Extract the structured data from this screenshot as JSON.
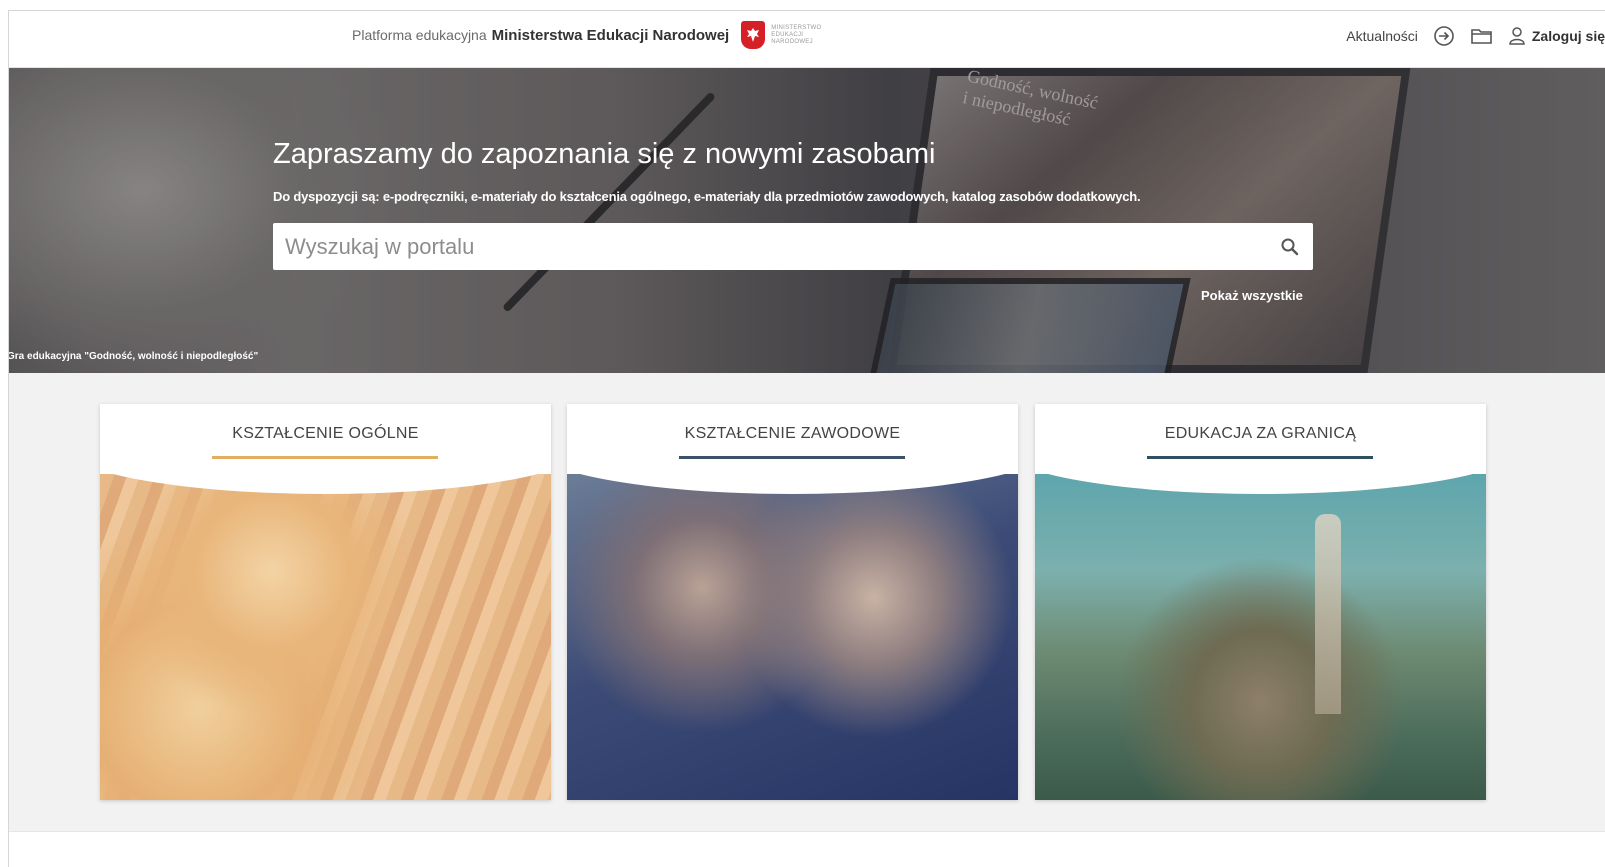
{
  "header": {
    "platform_prefix": "Platforma edukacyjna",
    "platform_name": "Ministerstwa Edukacji Narodowej",
    "logo_text_line1": "MINISTERSTWO",
    "logo_text_line2": "EDUKACJI",
    "logo_text_line3": "NARODOWEJ",
    "news_label": "Aktualności",
    "login_label": "Zaloguj się",
    "icons": [
      "login-arrow-icon",
      "folder-icon",
      "user-icon"
    ]
  },
  "hero": {
    "title": "Zapraszamy do zapoznania się z nowymi zasobami",
    "subtitle": "Do dyspozycji są: e-podręczniki, e-materiały do kształcenia ogólnego, e-materiały dla przedmiotów zawodowych, katalog zasobów dodatkowych.",
    "search_placeholder": "Wyszukaj w portalu",
    "show_all": "Pokaż wszystkie",
    "caption": "Gra edukacyjna \"Godność, wolność i niepodległość\"",
    "screen_label_1": "Godność, wolność",
    "screen_label_2": "i niepodległość"
  },
  "cards": [
    {
      "title": "KSZTAŁCENIE OGÓLNE",
      "accent": "#e0b060"
    },
    {
      "title": "KSZTAŁCENIE ZAWODOWE",
      "accent": "#3c5268"
    },
    {
      "title": "EDUKACJA ZA GRANICĄ",
      "accent": "#2e5060"
    }
  ]
}
